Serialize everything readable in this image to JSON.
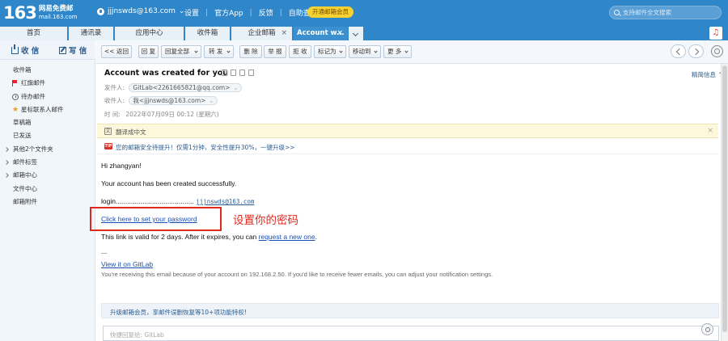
{
  "logo": {
    "number": "163",
    "line1": "网易免费邮",
    "line2": "mail.163.com"
  },
  "user": {
    "account": "jjjnswds@163.com"
  },
  "topnav": {
    "settings": "设置",
    "app": "官方App",
    "feedback": "反馈",
    "self_service": "自助查询"
  },
  "vip_button": "开通邮箱会员",
  "search": {
    "placeholder": "支持邮件全文搜索"
  },
  "tabs": [
    {
      "label": "首页"
    },
    {
      "label": "通讯录"
    },
    {
      "label": "应用中心"
    },
    {
      "label": "收件箱"
    },
    {
      "label": "企业邮箱"
    },
    {
      "label": "Account w..."
    }
  ],
  "sidebar": {
    "receive": "收 信",
    "write": "写 信",
    "folders": [
      {
        "label": "收件箱"
      },
      {
        "label": "红旗邮件"
      },
      {
        "label": "待办邮件"
      },
      {
        "label": "星标联系人邮件"
      },
      {
        "label": "草稿箱"
      },
      {
        "label": "已发送"
      },
      {
        "label": "其他2个文件夹"
      },
      {
        "label": "邮件标签"
      },
      {
        "label": "邮箱中心"
      },
      {
        "label": "文件中心"
      },
      {
        "label": "邮箱附件"
      }
    ]
  },
  "toolbar": {
    "back": "<< 返回",
    "reply": "回 复",
    "reply_all": "回复全部",
    "forward": "转 发",
    "delete": "删 除",
    "report": "举 报",
    "reject": "拒 收",
    "mark_as": "标记为",
    "move_to": "移动到",
    "more": "更 多"
  },
  "message": {
    "subject": "Account was created for you",
    "brief_info": "精简信息",
    "from_label": "发件人:",
    "from_value": "GitLab<2261665821@qq.com>",
    "to_label": "收件人:",
    "to_value": "我<jjjnswds@163.com>",
    "time_label": "时   间:",
    "time_value": "2022年07月09日 00:12 (星期六)",
    "translate": "翻译成中文",
    "security": "您的邮箱安全待提升！仅需1分钟，安全性提升30%，一键升级>>"
  },
  "body": {
    "greeting": "Hi zhangyan!",
    "created": "Your account has been created successfully.",
    "login_label": "login.........................................",
    "login_value": "jjjnswds@163.com",
    "set_password_link": "Click here to set your password",
    "annotation": "设置你的密码",
    "valid_prefix": "This link is valid for 2 days. After it expires, you can ",
    "valid_link": "request a new one",
    "valid_suffix": ".",
    "sig_sep": "—",
    "view_link": "View it on GitLab",
    "footer": "You're receiving this email because of your account on 192.168.2.50. If you'd like to receive fewer emails, you can adjust your notification settings."
  },
  "upgrade_bar": "升级邮箱会员，享邮件误删恢复等10+项功能特权!",
  "quick_reply": {
    "placeholder": "快捷回复给: GitLab"
  }
}
